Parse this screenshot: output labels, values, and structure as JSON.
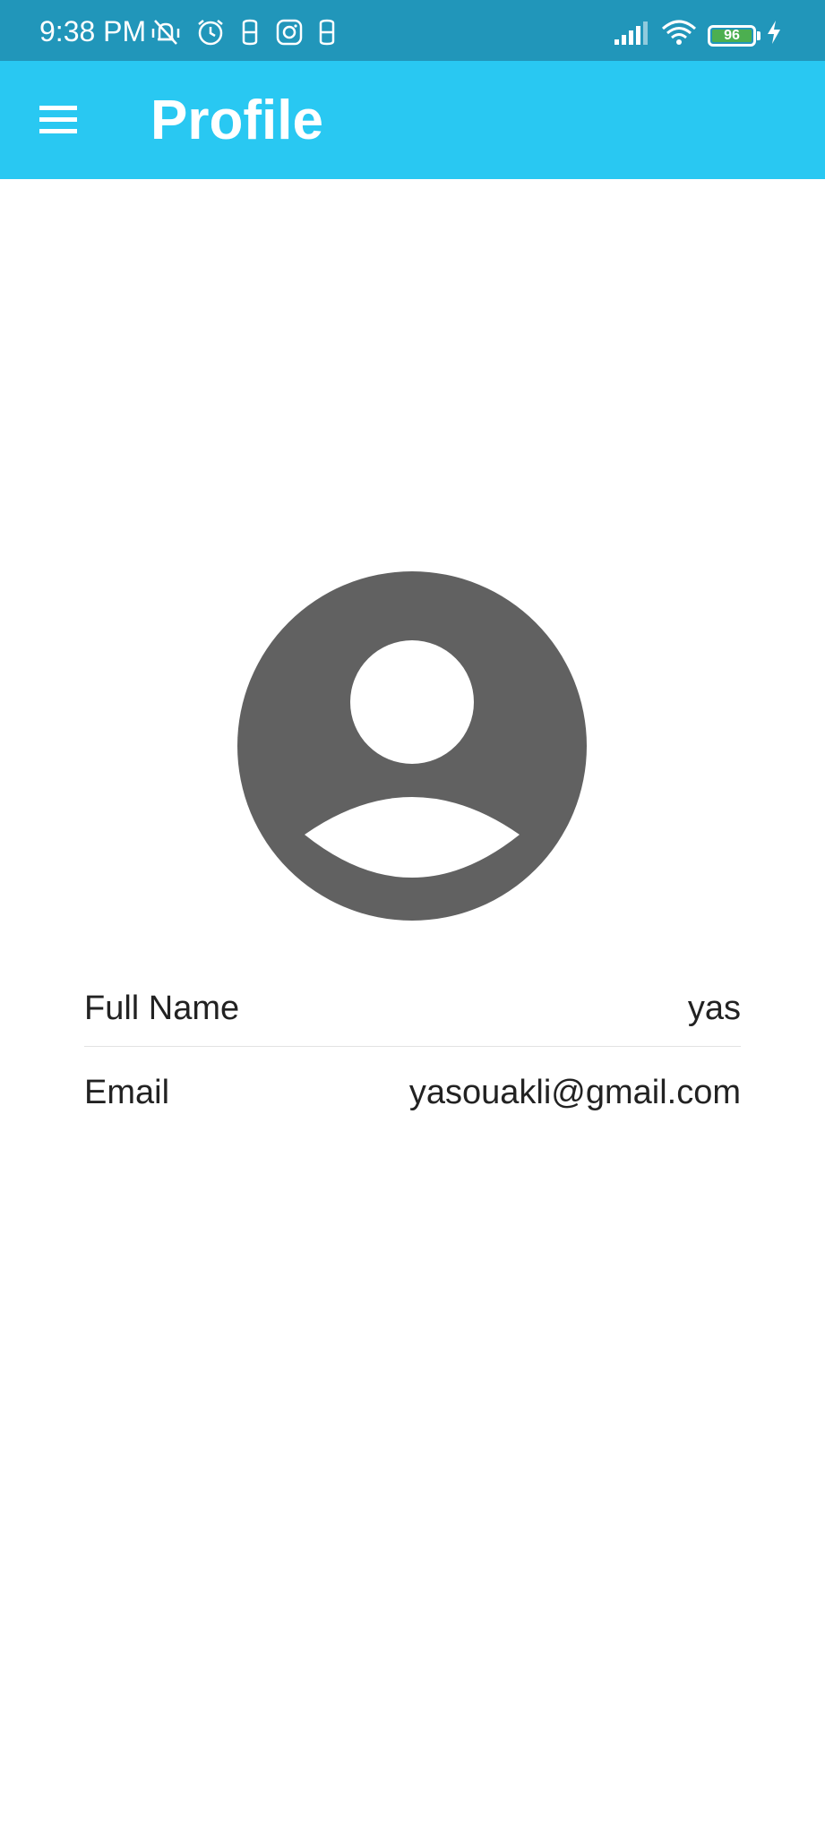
{
  "status_bar": {
    "time": "9:38 PM",
    "battery_level": "96",
    "icons": [
      "vibrate-icon",
      "alarm-icon",
      "app-s-icon",
      "instagram-icon",
      "app-s-icon",
      "signal-icon",
      "wifi-icon",
      "battery-icon",
      "charging-icon"
    ],
    "background_color": "#2196ba"
  },
  "app_bar": {
    "title": "Profile",
    "menu_icon": "hamburger-menu-icon",
    "background_color": "#29c8f2"
  },
  "profile": {
    "avatar_icon": "account-circle-icon",
    "avatar_color": "#616161",
    "fields": [
      {
        "label": "Full Name",
        "value": "yas"
      },
      {
        "label": "Email",
        "value": "yasouakli@gmail.com"
      }
    ]
  }
}
